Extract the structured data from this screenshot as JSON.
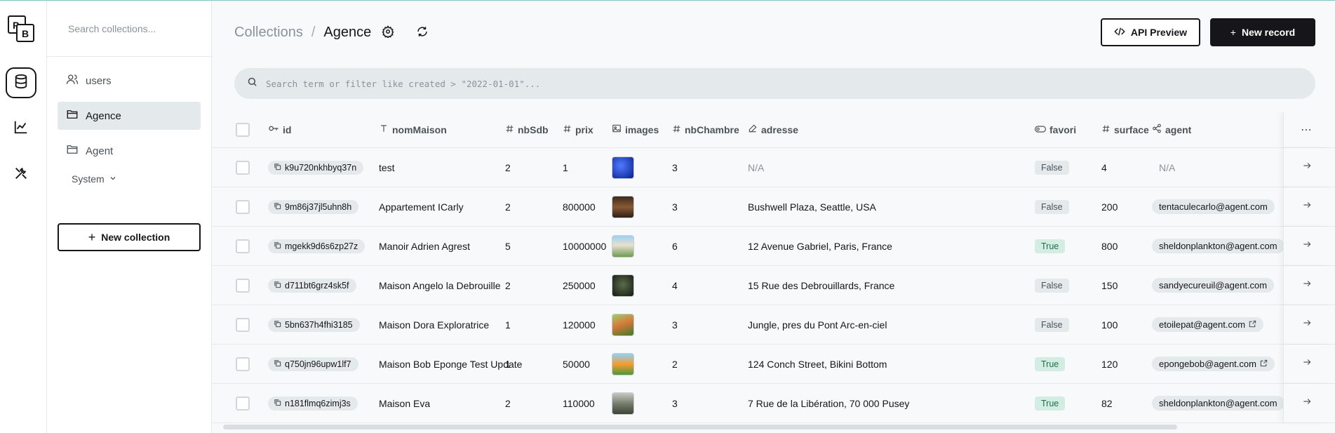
{
  "sidebar": {
    "search_placeholder": "Search collections...",
    "collections": [
      {
        "label": "users",
        "icon": "user-icon"
      },
      {
        "label": "Agence",
        "icon": "folder-icon",
        "active": true
      },
      {
        "label": "Agent",
        "icon": "folder-icon"
      }
    ],
    "system_label": "System",
    "new_collection_label": "New collection"
  },
  "header": {
    "breadcrumb_root": "Collections",
    "breadcrumb_sep": "/",
    "breadcrumb_current": "Agence",
    "api_preview_label": "API Preview",
    "new_record_label": "New record"
  },
  "search": {
    "placeholder": "Search term or filter like created > \"2022-01-01\"..."
  },
  "table": {
    "columns": [
      "id",
      "nomMaison",
      "nbSdb",
      "prix",
      "images",
      "nbChambre",
      "adresse",
      "favori",
      "surface",
      "agent"
    ],
    "rows": [
      {
        "id": "k9u720nkhbyq37n",
        "nomMaison": "test",
        "nbSdb": "2",
        "prix": "1",
        "nbChambre": "3",
        "adresse": "N/A",
        "favori": "False",
        "surface": "4",
        "agent": "N/A",
        "image_color": "#1a3fbf"
      },
      {
        "id": "9m86j37jl5uhn8h",
        "nomMaison": "Appartement ICarly",
        "nbSdb": "2",
        "prix": "800000",
        "nbChambre": "3",
        "adresse": "Bushwell Plaza, Seattle, USA",
        "favori": "False",
        "surface": "200",
        "agent": "tentaculecarlo@agent.com",
        "image_color": "#6b4a2e"
      },
      {
        "id": "mgekk9d6s6zp27z",
        "nomMaison": "Manoir Adrien Agrest",
        "nbSdb": "5",
        "prix": "10000000",
        "nbChambre": "6",
        "adresse": "12 Avenue Gabriel, Paris, France",
        "favori": "True",
        "surface": "800",
        "agent": "sheldonplankton@agent.com",
        "image_color": "#b7c9a8"
      },
      {
        "id": "d711bt6grz4sk5f",
        "nomMaison": "Maison Angelo la Debrouille",
        "nbSdb": "2",
        "prix": "250000",
        "nbChambre": "4",
        "adresse": "15 Rue des Debrouillards, France",
        "favori": "False",
        "surface": "150",
        "agent": "sandyecureuil@agent.com",
        "image_color": "#2f3a2a"
      },
      {
        "id": "5bn637h4fhi3185",
        "nomMaison": "Maison Dora Exploratrice",
        "nbSdb": "1",
        "prix": "120000",
        "nbChambre": "3",
        "adresse": "Jungle, pres du Pont Arc-en-ciel",
        "favori": "False",
        "surface": "100",
        "agent": "etoilepat@agent.com",
        "image_color": "#5c8f3c"
      },
      {
        "id": "q750jn96upw1lf7",
        "nomMaison": "Maison Bob Eponge Test Update",
        "nbSdb": "1",
        "prix": "50000",
        "nbChambre": "2",
        "adresse": "124 Conch Street, Bikini Bottom",
        "favori": "True",
        "surface": "120",
        "agent": "epongebob@agent.com",
        "image_color": "#e8943a"
      },
      {
        "id": "n181flmq6zimj3s",
        "nomMaison": "Maison Eva",
        "nbSdb": "2",
        "prix": "110000",
        "nbChambre": "3",
        "adresse": "7 Rue de la Libération, 70 000 Pusey",
        "favori": "True",
        "surface": "82",
        "agent": "sheldonplankton@agent.com",
        "image_color": "#7d8a7a"
      }
    ]
  }
}
